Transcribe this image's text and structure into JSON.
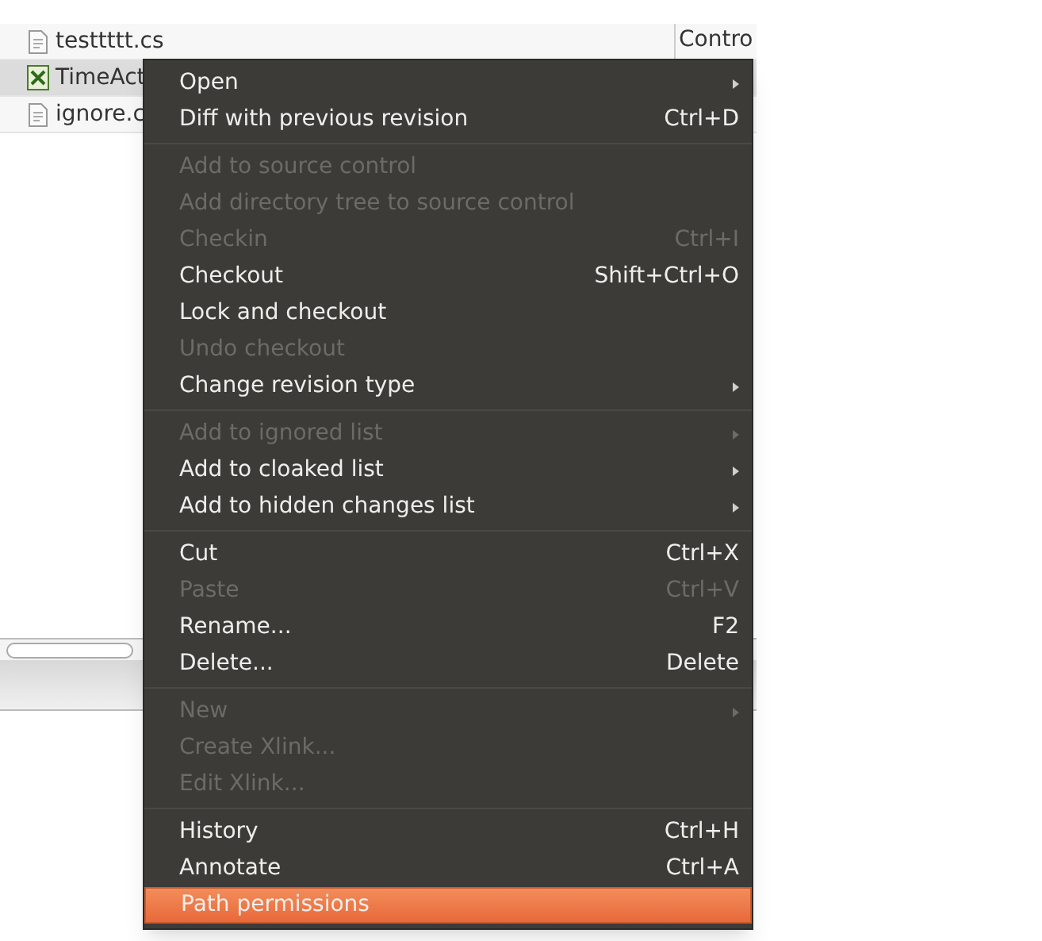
{
  "file_list": {
    "rows": [
      {
        "name": "testtttt.cs",
        "kind": "document",
        "column_2": "Contro",
        "selected": false
      },
      {
        "name": "TimeAct",
        "kind": "spreadsheet",
        "selected": true
      },
      {
        "name": "ignore.c",
        "kind": "document",
        "selected": false
      }
    ]
  },
  "context_menu": {
    "items": [
      {
        "kind": "item",
        "label": "Open",
        "submenu": true,
        "disabled": false,
        "selected": false
      },
      {
        "kind": "item",
        "label": "Diff with previous revision",
        "shortcut": "Ctrl+D",
        "disabled": false,
        "selected": false
      },
      {
        "kind": "separator"
      },
      {
        "kind": "item",
        "label": "Add to source control",
        "disabled": true,
        "selected": false
      },
      {
        "kind": "item",
        "label": "Add directory tree to source control",
        "disabled": true,
        "selected": false
      },
      {
        "kind": "item",
        "label": "Checkin",
        "shortcut": "Ctrl+I",
        "disabled": true,
        "selected": false
      },
      {
        "kind": "item",
        "label": "Checkout",
        "shortcut": "Shift+Ctrl+O",
        "disabled": false,
        "selected": false
      },
      {
        "kind": "item",
        "label": "Lock and checkout",
        "disabled": false,
        "selected": false
      },
      {
        "kind": "item",
        "label": "Undo checkout",
        "disabled": true,
        "selected": false
      },
      {
        "kind": "item",
        "label": "Change revision type",
        "submenu": true,
        "disabled": false,
        "selected": false
      },
      {
        "kind": "separator"
      },
      {
        "kind": "item",
        "label": "Add to ignored list",
        "submenu": true,
        "disabled": true,
        "selected": false
      },
      {
        "kind": "item",
        "label": "Add to cloaked list",
        "submenu": true,
        "disabled": false,
        "selected": false
      },
      {
        "kind": "item",
        "label": "Add to hidden changes list",
        "submenu": true,
        "disabled": false,
        "selected": false
      },
      {
        "kind": "separator"
      },
      {
        "kind": "item",
        "label": "Cut",
        "shortcut": "Ctrl+X",
        "disabled": false,
        "selected": false
      },
      {
        "kind": "item",
        "label": "Paste",
        "shortcut": "Ctrl+V",
        "disabled": true,
        "selected": false
      },
      {
        "kind": "item",
        "label": "Rename...",
        "shortcut": "F2",
        "disabled": false,
        "selected": false
      },
      {
        "kind": "item",
        "label": "Delete...",
        "shortcut": "Delete",
        "disabled": false,
        "selected": false
      },
      {
        "kind": "separator"
      },
      {
        "kind": "item",
        "label": "New",
        "submenu": true,
        "disabled": true,
        "selected": false
      },
      {
        "kind": "item",
        "label": "Create Xlink...",
        "disabled": true,
        "selected": false
      },
      {
        "kind": "item",
        "label": "Edit Xlink...",
        "disabled": true,
        "selected": false
      },
      {
        "kind": "separator"
      },
      {
        "kind": "item",
        "label": "History",
        "shortcut": "Ctrl+H",
        "disabled": false,
        "selected": false
      },
      {
        "kind": "item",
        "label": "Annotate",
        "shortcut": "Ctrl+A",
        "disabled": false,
        "selected": false
      },
      {
        "kind": "item",
        "label": "Path permissions",
        "disabled": false,
        "selected": true
      }
    ]
  }
}
